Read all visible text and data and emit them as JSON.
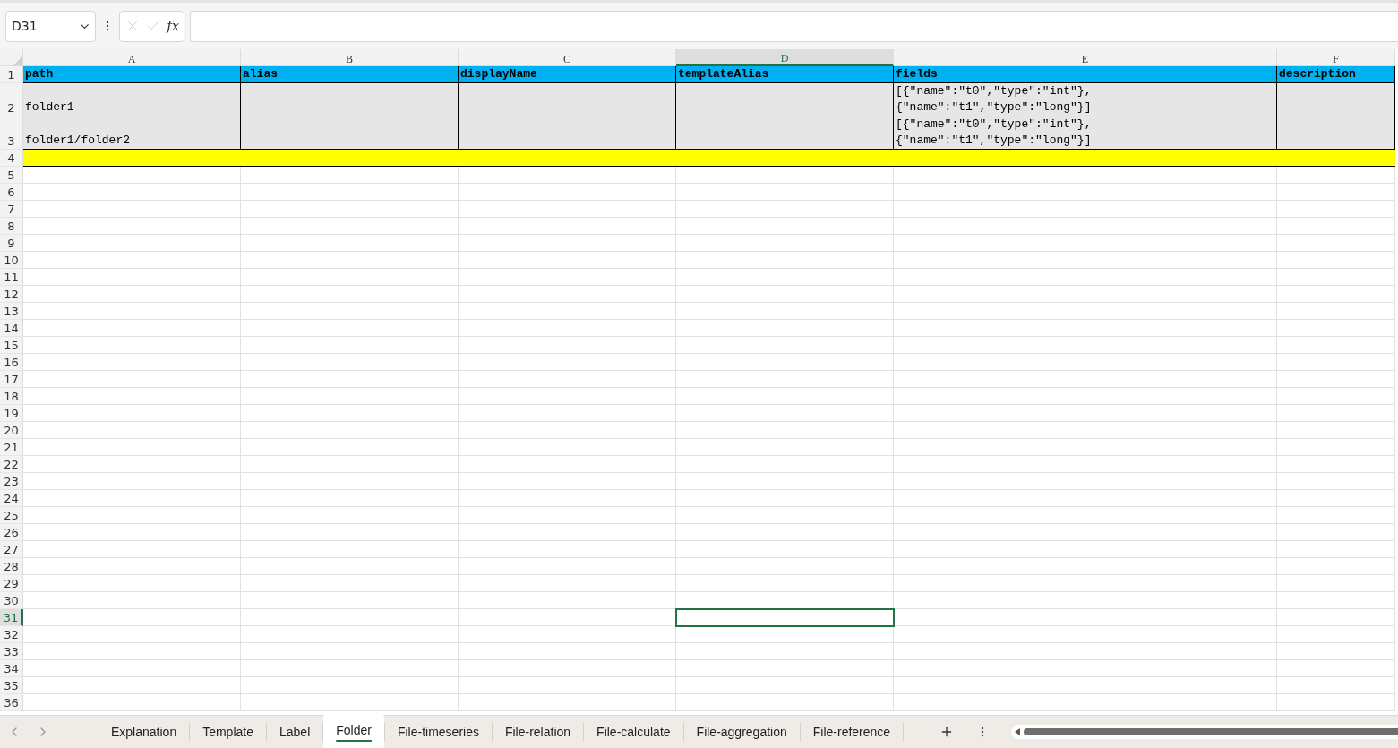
{
  "formula_bar": {
    "name_box": "D31",
    "function_label": "fx"
  },
  "columns": [
    {
      "label": "A",
      "selected": false
    },
    {
      "label": "B",
      "selected": false
    },
    {
      "label": "C",
      "selected": false
    },
    {
      "label": "D",
      "selected": true
    },
    {
      "label": "E",
      "selected": false
    },
    {
      "label": "F",
      "selected": false
    }
  ],
  "rows": [
    {
      "label": "1",
      "kind": "header",
      "selected": false,
      "cells": [
        {
          "text": "path"
        },
        {
          "text": "alias"
        },
        {
          "text": "displayName"
        },
        {
          "text": "templateAlias"
        },
        {
          "text": "fields"
        },
        {
          "text": "description"
        }
      ]
    },
    {
      "label": "2",
      "kind": "data",
      "selected": false,
      "cells": [
        {
          "text": "folder1"
        },
        {},
        {},
        {},
        {
          "text": "[{″name″:″t0″,″type″:″int″},\n{″name″:″t1″,″type″:″long″}]"
        },
        {}
      ]
    },
    {
      "label": "3",
      "kind": "data",
      "selected": false,
      "cells": [
        {
          "text": "folder1/folder2"
        },
        {},
        {},
        {},
        {
          "text": "[{″name″:″t0″,″type″:″int″},\n{″name″:″t1″,″type″:″long″}]"
        },
        {}
      ]
    },
    {
      "label": "4",
      "kind": "band",
      "selected": false
    },
    {
      "label": "5",
      "kind": "empty",
      "selected": false
    },
    {
      "label": "6",
      "kind": "empty",
      "selected": false
    },
    {
      "label": "7",
      "kind": "empty",
      "selected": false
    },
    {
      "label": "8",
      "kind": "empty",
      "selected": false
    },
    {
      "label": "9",
      "kind": "empty",
      "selected": false
    },
    {
      "label": "10",
      "kind": "empty",
      "selected": false
    },
    {
      "label": "11",
      "kind": "empty",
      "selected": false
    },
    {
      "label": "12",
      "kind": "empty",
      "selected": false
    },
    {
      "label": "13",
      "kind": "empty",
      "selected": false
    },
    {
      "label": "14",
      "kind": "empty",
      "selected": false
    },
    {
      "label": "15",
      "kind": "empty",
      "selected": false
    },
    {
      "label": "16",
      "kind": "empty",
      "selected": false
    },
    {
      "label": "17",
      "kind": "empty",
      "selected": false
    },
    {
      "label": "18",
      "kind": "empty",
      "selected": false
    },
    {
      "label": "19",
      "kind": "empty",
      "selected": false
    },
    {
      "label": "20",
      "kind": "empty",
      "selected": false
    },
    {
      "label": "21",
      "kind": "empty",
      "selected": false
    },
    {
      "label": "22",
      "kind": "empty",
      "selected": false
    },
    {
      "label": "23",
      "kind": "empty",
      "selected": false
    },
    {
      "label": "24",
      "kind": "empty",
      "selected": false
    },
    {
      "label": "25",
      "kind": "empty",
      "selected": false
    },
    {
      "label": "26",
      "kind": "empty",
      "selected": false
    },
    {
      "label": "27",
      "kind": "empty",
      "selected": false
    },
    {
      "label": "28",
      "kind": "empty",
      "selected": false
    },
    {
      "label": "29",
      "kind": "empty",
      "selected": false
    },
    {
      "label": "30",
      "kind": "empty",
      "selected": false
    },
    {
      "label": "31",
      "kind": "empty",
      "selected": true
    },
    {
      "label": "32",
      "kind": "empty",
      "selected": false
    },
    {
      "label": "33",
      "kind": "empty",
      "selected": false
    },
    {
      "label": "34",
      "kind": "empty",
      "selected": false
    },
    {
      "label": "35",
      "kind": "empty",
      "selected": false
    },
    {
      "label": "36",
      "kind": "empty",
      "selected": false
    }
  ],
  "sheet_tabs": [
    {
      "label": "Explanation",
      "selected": false
    },
    {
      "label": "Template",
      "selected": false
    },
    {
      "label": "Label",
      "selected": false
    },
    {
      "label": "Folder",
      "selected": true
    },
    {
      "label": "File-timeseries",
      "selected": false
    },
    {
      "label": "File-relation",
      "selected": false
    },
    {
      "label": "File-calculate",
      "selected": false
    },
    {
      "label": "File-aggregation",
      "selected": false
    },
    {
      "label": "File-reference",
      "selected": false
    }
  ]
}
